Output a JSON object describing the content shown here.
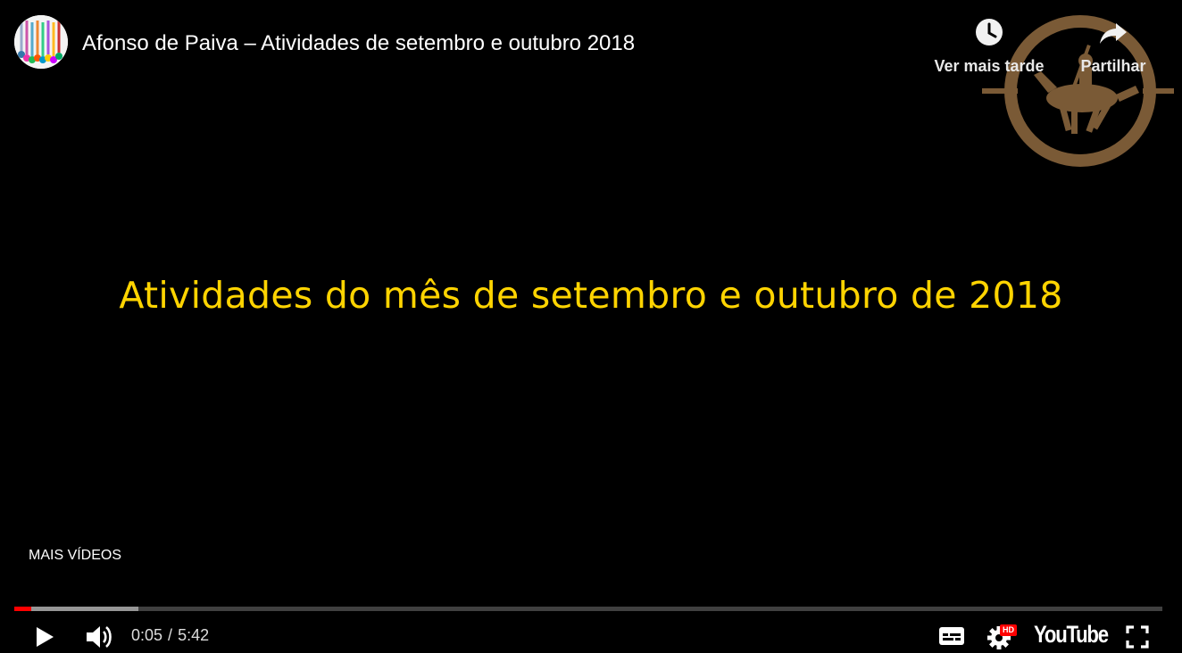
{
  "header": {
    "title": "Afonso de Paiva – Atividades de setembro e outubro 2018",
    "watch_later_label": "Ver mais tarde",
    "share_label": "Partilhar"
  },
  "slide": {
    "text": "Atividades do mês de setembro e outubro de 2018",
    "text_color": "#ffd400"
  },
  "more_videos_label": "MAIS VÍDEOS",
  "progress": {
    "played_fraction": 0.015,
    "buffered_fraction": 0.108,
    "played_color": "#ff0000"
  },
  "controls": {
    "current_time": "0:05",
    "separator": "/",
    "duration": "5:42",
    "hd_badge": "HD",
    "logo_text": "YouTube"
  },
  "icons": {
    "play": "play-icon",
    "volume": "volume-icon",
    "captions": "captions-icon",
    "settings": "settings-gear-icon",
    "fullscreen": "fullscreen-icon",
    "watch_later": "clock-icon",
    "share": "share-arrow-icon"
  }
}
